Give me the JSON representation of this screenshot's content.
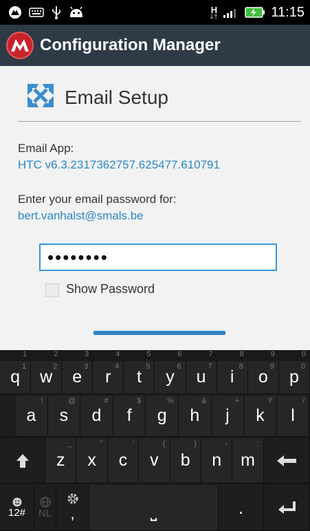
{
  "status_bar": {
    "time": "11:15",
    "network_type": "H",
    "icons": [
      "app-notification-icon",
      "keyboard-icon",
      "usb-icon",
      "android-icon",
      "signal-icon",
      "battery-charging-icon"
    ]
  },
  "app_bar": {
    "title": "Configuration Manager",
    "logo": "mobileiron-logo-icon"
  },
  "email_setup": {
    "title": "Email Setup",
    "title_icon": "exchange-icon",
    "email_app_label": "Email App:",
    "email_app_value": "HTC v6.3.2317362757.625477.610791",
    "password_prompt": "Enter your email password for:",
    "email_address": "bert.vanhalst@smals.be",
    "password_value": "••••••••",
    "show_password_label": "Show Password",
    "show_password_checked": false
  },
  "keyboard": {
    "number_hints": [
      "1",
      "2",
      "3",
      "4",
      "5",
      "6",
      "7",
      "8",
      "9",
      "0"
    ],
    "row1": [
      {
        "k": "q",
        "h": "1"
      },
      {
        "k": "w",
        "h": "2"
      },
      {
        "k": "e",
        "h": "3"
      },
      {
        "k": "r",
        "h": "4"
      },
      {
        "k": "t",
        "h": "5"
      },
      {
        "k": "y",
        "h": "6"
      },
      {
        "k": "u",
        "h": "7"
      },
      {
        "k": "i",
        "h": "8"
      },
      {
        "k": "o",
        "h": "9"
      },
      {
        "k": "p",
        "h": "0"
      }
    ],
    "row2": [
      {
        "k": "a",
        "h": "!"
      },
      {
        "k": "s",
        "h": "@"
      },
      {
        "k": "d",
        "h": "#"
      },
      {
        "k": "f",
        "h": "$"
      },
      {
        "k": "g",
        "h": "%"
      },
      {
        "k": "h",
        "h": "&"
      },
      {
        "k": "j",
        "h": "+"
      },
      {
        "k": "k",
        "h": "?"
      },
      {
        "k": "l",
        "h": "/"
      }
    ],
    "row3": [
      {
        "k": "z",
        "h": "_"
      },
      {
        "k": "x",
        "h": "\""
      },
      {
        "k": "c",
        "h": "'"
      },
      {
        "k": "v",
        "h": "("
      },
      {
        "k": "b",
        "h": ")"
      },
      {
        "k": "n",
        "h": "-"
      },
      {
        "k": "m",
        "h": ":"
      }
    ],
    "shift_label": "↑",
    "backspace_label": "←",
    "symbols_label": "12#",
    "language_label": "NL",
    "comma_label": ",",
    "space_label": "⎵",
    "period_label": ".",
    "enter_label": "↵"
  }
}
